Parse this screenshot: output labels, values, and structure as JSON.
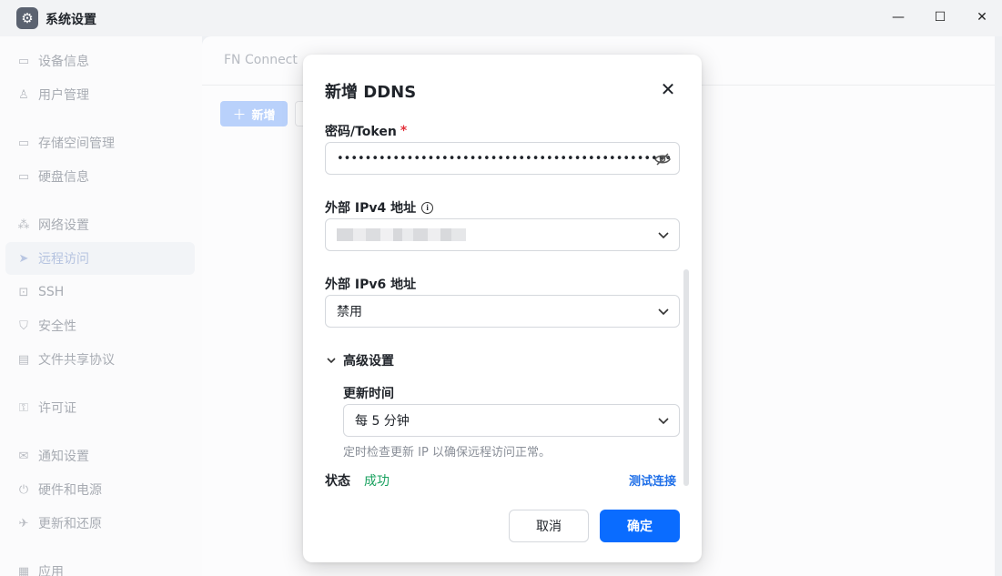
{
  "window": {
    "title": "系统设置",
    "minimize": "—",
    "maximize": "☐",
    "close": "✕"
  },
  "sidebar": {
    "items": [
      {
        "label": "设备信息",
        "icon": "monitor-icon"
      },
      {
        "label": "用户管理",
        "icon": "user-icon"
      },
      {
        "label": "存储空间管理",
        "icon": "storage-icon"
      },
      {
        "label": "硬盘信息",
        "icon": "disk-icon"
      },
      {
        "label": "网络设置",
        "icon": "network-icon"
      },
      {
        "label": "远程访问",
        "icon": "send-icon",
        "active": true
      },
      {
        "label": "SSH",
        "icon": "code-icon"
      },
      {
        "label": "安全性",
        "icon": "shield-icon"
      },
      {
        "label": "文件共享协议",
        "icon": "file-icon"
      },
      {
        "label": "许可证",
        "icon": "key-icon"
      },
      {
        "label": "通知设置",
        "icon": "mail-icon"
      },
      {
        "label": "硬件和电源",
        "icon": "power-icon"
      },
      {
        "label": "更新和还原",
        "icon": "rocket-icon"
      },
      {
        "label": "应用",
        "icon": "app-icon"
      }
    ]
  },
  "main": {
    "tab": "FN Connect",
    "add_button": "新增",
    "add_icon": "＋"
  },
  "dialog": {
    "title": "新增 DDNS",
    "close_glyph": "✕",
    "token": {
      "label": "密码/Token",
      "required_mark": "*",
      "value": "••••••••••••••••••••••••••••••••••••••••••••••••"
    },
    "ipv4": {
      "label": "外部 IPv4 地址",
      "info_glyph": "i"
    },
    "ipv6": {
      "label": "外部 IPv6 地址",
      "value": "禁用"
    },
    "advanced": {
      "label": "高级设置",
      "update_time_label": "更新时间",
      "update_time_value": "每 5 分钟",
      "hint": "定时检查更新 IP 以确保远程访问正常。"
    },
    "status": {
      "label": "状态",
      "value": "成功",
      "value_color": "#19a15f"
    },
    "test_link": "测试连接",
    "cancel": "取消",
    "confirm": "确定",
    "accent_color": "#0a6cff"
  }
}
